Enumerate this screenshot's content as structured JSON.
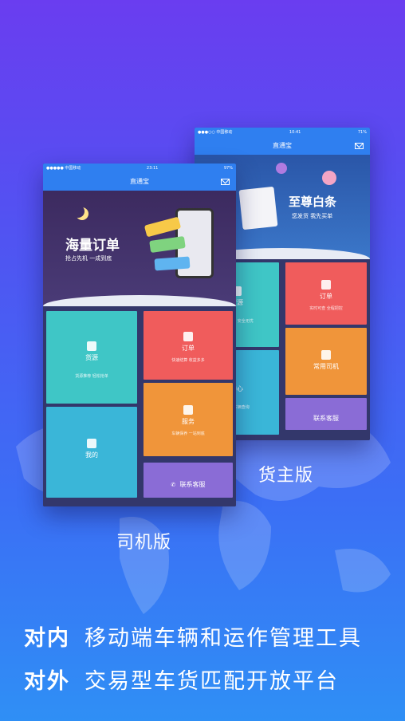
{
  "phone_back": {
    "status_left": "●●●○○ 中国移动",
    "status_time": "10:41",
    "status_right": "71%",
    "title": "直通宝",
    "banner_title": "至尊白条",
    "banner_sub": "您发货  我先买单",
    "tiles": {
      "left_top_label": "货源",
      "left_top_desc": "轻松发货  安全无忧",
      "left_bottom_label": "中心",
      "left_bottom_desc": "抢单  车辆查询",
      "order_label": "订单",
      "order_desc": "实时可查  全程把控",
      "driver_label": "常用司机",
      "contact_label": "联系客服"
    }
  },
  "phone_front": {
    "status_left": "●●●●● 中国移动",
    "status_time": "23:11",
    "status_right": "97%",
    "title": "直通宝",
    "banner_title": "海量订单",
    "banner_sub": "抢占先机   一成到底",
    "tiles": {
      "source_label": "货源",
      "source_desc": "货源推荐  轻松抢单",
      "order_label": "订单",
      "order_desc": "快速结算  收益多多",
      "service_label": "服务",
      "service_desc": "车辆保养  一站到底",
      "mine_label": "我的",
      "contact_label": "联系客服"
    }
  },
  "captions": {
    "shipper": "货主版",
    "driver": "司机版"
  },
  "slogans": [
    {
      "head": "对内",
      "text": "移动端车辆和运作管理工具"
    },
    {
      "head": "对外",
      "text": "交易型车货匹配开放平台"
    }
  ]
}
